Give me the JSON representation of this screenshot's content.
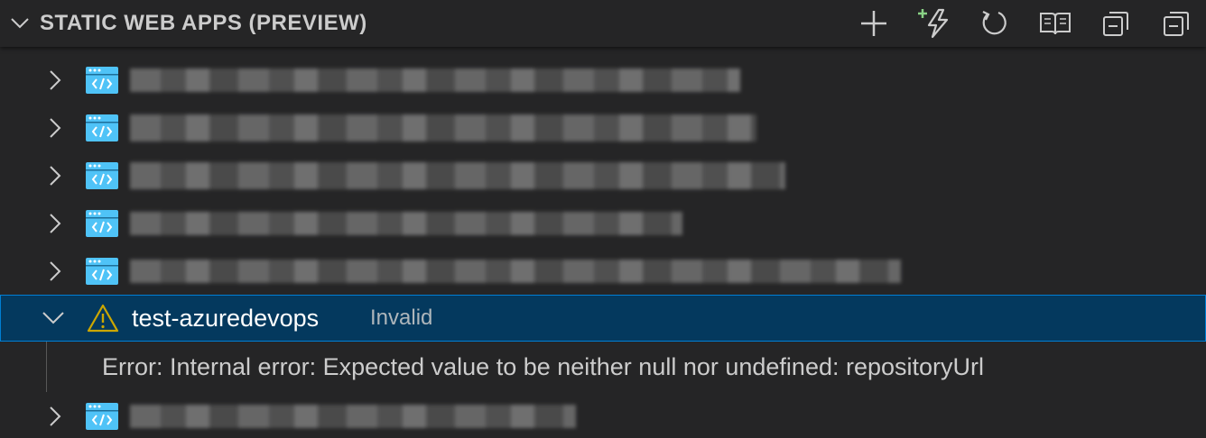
{
  "header": {
    "title": "STATIC WEB APPS (PREVIEW)",
    "actions": [
      {
        "name": "create-static-web-app",
        "icon": "plus-icon"
      },
      {
        "name": "create-advanced",
        "icon": "lightning-plus-icon"
      },
      {
        "name": "refresh",
        "icon": "refresh-icon"
      },
      {
        "name": "open-docs",
        "icon": "book-icon"
      },
      {
        "name": "collapse-all",
        "icon": "collapse-all-icon"
      },
      {
        "name": "collapse",
        "icon": "collapse-icon"
      }
    ]
  },
  "tree": {
    "items": [
      {
        "label": "",
        "redacted": true,
        "icon": "static-web-app-icon",
        "expanded": false
      },
      {
        "label": "",
        "redacted": true,
        "icon": "static-web-app-icon",
        "expanded": false
      },
      {
        "label": "",
        "redacted": true,
        "icon": "static-web-app-icon",
        "expanded": false
      },
      {
        "label": "",
        "redacted": true,
        "icon": "static-web-app-icon",
        "expanded": false
      },
      {
        "label": "",
        "redacted": true,
        "icon": "static-web-app-icon",
        "expanded": false
      },
      {
        "label": "test-azuredevops",
        "description": "Invalid",
        "icon": "warning-icon",
        "expanded": true,
        "selected": true,
        "children": [
          {
            "label": "Error: Internal error: Expected value to be neither null nor undefined: repositoryUrl"
          }
        ]
      },
      {
        "label": "",
        "redacted": true,
        "icon": "static-web-app-icon",
        "expanded": false
      }
    ]
  },
  "colors": {
    "background": "#252526",
    "selection": "#04395e",
    "focus_border": "#007fd4",
    "app_icon": "#4fc3f7",
    "warning": "#cca700",
    "lightning": "#89d185"
  }
}
